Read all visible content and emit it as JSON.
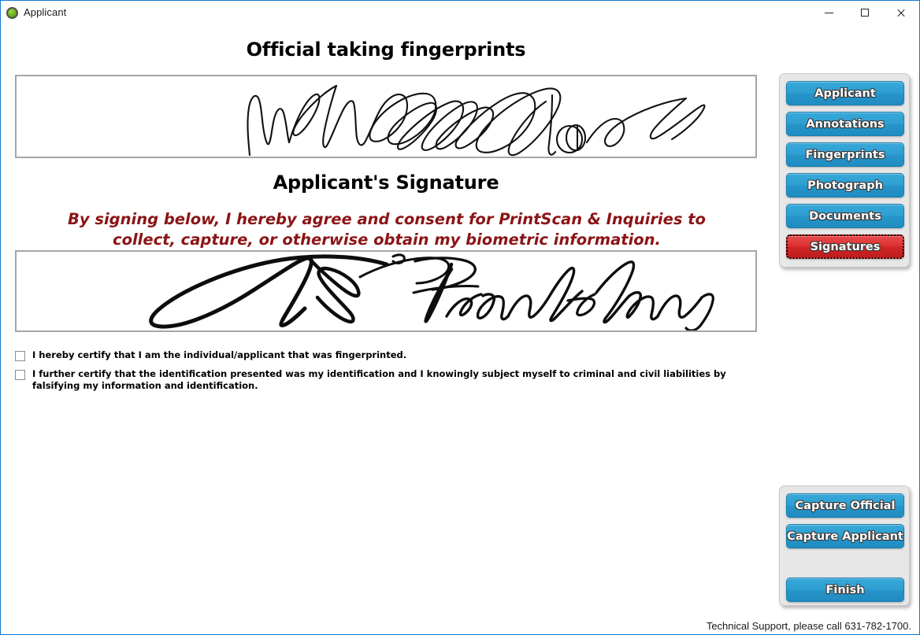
{
  "window": {
    "title": "Applicant",
    "icon": "green-status-circle-icon",
    "border_color": "#1278cf",
    "controls": [
      {
        "name": "minimize",
        "glyph": "minimize-icon"
      },
      {
        "name": "maximize",
        "glyph": "maximize-icon"
      },
      {
        "name": "close",
        "glyph": "close-icon"
      }
    ]
  },
  "main": {
    "official_heading": "Official taking fingerprints",
    "applicant_heading": "Applicant's Signature",
    "consent_text": "By signing below, I hereby agree and consent for PrintScan & Inquiries to collect, capture, or otherwise obtain my biometric information.",
    "consent_color": "#8b1416",
    "official_signature_alt": "official-scribbled-signature",
    "applicant_signature_alt": "applicant-signature-b-franklin",
    "checkboxes": [
      {
        "checked": false,
        "label": "I hereby certify that I am the individual/applicant that was fingerprinted."
      },
      {
        "checked": false,
        "label": "I further certify that the identification presented was my identification and I knowingly subject myself to criminal and civil liabilities by falsifying my information and identification."
      }
    ]
  },
  "nav_panel": {
    "buttons": [
      {
        "label": "Applicant",
        "state": "normal"
      },
      {
        "label": "Annotations",
        "state": "normal"
      },
      {
        "label": "Fingerprints",
        "state": "normal"
      },
      {
        "label": "Photograph",
        "state": "normal"
      },
      {
        "label": "Documents",
        "state": "normal"
      },
      {
        "label": "Signatures",
        "state": "selected"
      }
    ],
    "normal_color": "#2795c9",
    "selected_color": "#cf2525"
  },
  "action_panel": {
    "buttons": [
      {
        "label": "Capture Official"
      },
      {
        "label": "Capture Applicant"
      },
      {
        "label": "Finish"
      }
    ]
  },
  "footer": {
    "support_text": "Technical Support, please call 631-782-1700."
  }
}
